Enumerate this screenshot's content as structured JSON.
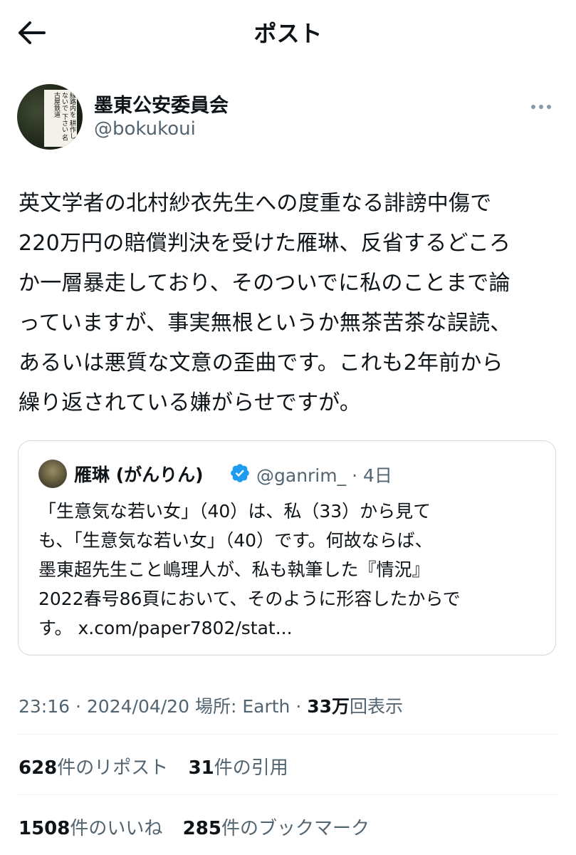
{
  "header": {
    "title": "ポスト",
    "back_icon": "arrow-left-icon"
  },
  "author": {
    "display_name": "墨東公安委員会",
    "handle": "@bokukoui",
    "avatar_sign_text": "線路内を 耕作しないで 下さい 名古屋鉄道"
  },
  "post": {
    "text": "英文学者の北村紗衣先生への度重なる誹謗中傷で\n220万円の賠償判決を受けた雁琳、反省するどころ\nか一層暴走しており、そのついでに私のことまで論\nっていますが、事実無根というか無茶苦茶な誤読、\nあるいは悪質な文意の歪曲です。これも2年前から\n繰り返されている嫌がらせですが。"
  },
  "quote": {
    "name": "雁琳 (がんりん)",
    "verified_icon": "verified-badge-icon",
    "handle": "@ganrim_",
    "time": "· 4日",
    "text": "「生意気な若い女」（40）は、私（33）から見て\nも、「生意気な若い女」（40）です。何故ならば、\n墨東超先生こと嶋理人が、私も執筆した『情況』\n2022春号86頁において、そのように形容したからで\nす。 x.com/paper7802/stat..."
  },
  "meta": {
    "time": "23:16",
    "date": "2024/04/20",
    "location_label": "場所: Earth",
    "views_count": "33万",
    "views_label": "回表示"
  },
  "stats": {
    "reposts_count": "628",
    "reposts_label": "件のリポスト",
    "quotes_count": "31",
    "quotes_label": "件の引用",
    "likes_count": "1508",
    "likes_label": "件のいいね",
    "bookmarks_count": "285",
    "bookmarks_label": "件のブックマーク"
  },
  "colors": {
    "text": "#0f1419",
    "secondary": "#536471",
    "border": "#cfd9de",
    "verified": "#1d9bf0"
  }
}
